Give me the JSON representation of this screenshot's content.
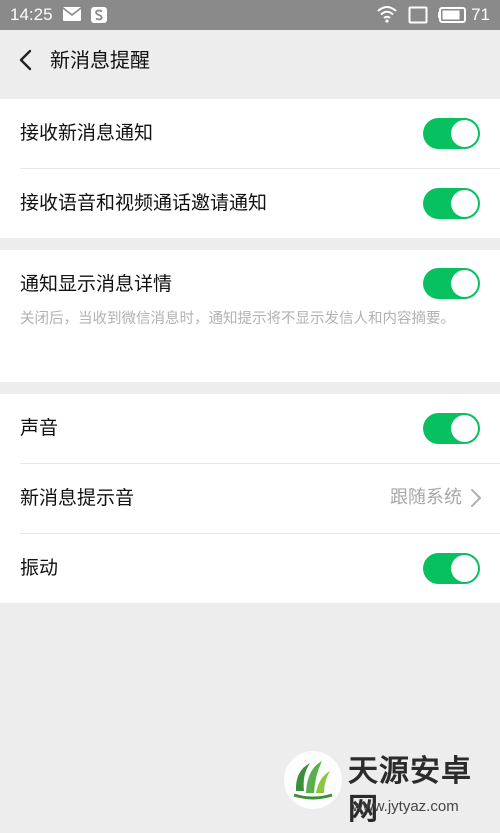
{
  "status_bar": {
    "time": "14:25",
    "battery": "71",
    "icons": [
      "mail-icon",
      "s-app-icon",
      "wifi-icon",
      "screen-icon",
      "battery-icon"
    ]
  },
  "header": {
    "title": "新消息提醒",
    "back_icon": "chevron-left-icon"
  },
  "section1": {
    "items": [
      {
        "label": "接收新消息通知",
        "toggle": true
      },
      {
        "label": "接收语音和视频通话邀请通知",
        "toggle": true
      }
    ]
  },
  "section2": {
    "label": "通知显示消息详情",
    "toggle": true,
    "description": "关闭后，当收到微信消息时，通知提示将不显示发信人和内容摘要。"
  },
  "section3": {
    "items": [
      {
        "label": "声音",
        "toggle": true
      },
      {
        "label": "新消息提示音",
        "value": "跟随系统"
      },
      {
        "label": "振动",
        "toggle": true
      }
    ]
  },
  "colors": {
    "accent": "#07c160",
    "background": "#ededed",
    "status_bar": "#8a8a8a"
  },
  "watermark": {
    "name": "天源安卓网",
    "url": "www.jytyaz.com"
  }
}
